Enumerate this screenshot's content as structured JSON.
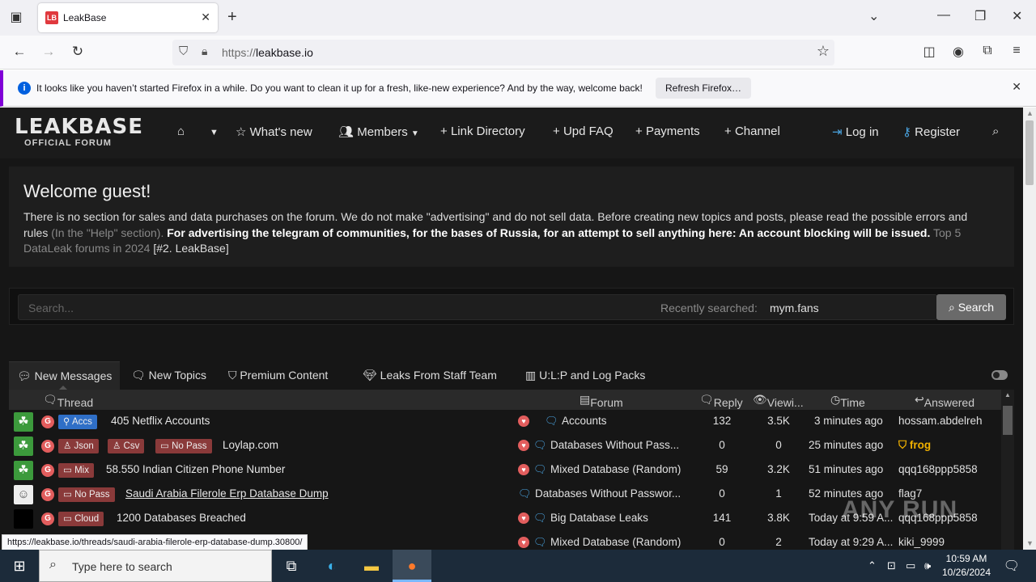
{
  "browser": {
    "tab_title": "LeakBase",
    "favicon_text": "LB",
    "url_host": "https://",
    "url_domain": "leakbase.io",
    "notice_message": "It looks like you haven’t started Firefox in a while. Do you want to clean it up for a fresh, like-new experience? And by the way, welcome back!",
    "notice_button": "Refresh Firefox…",
    "status_url": "https://leakbase.io/threads/saudi-arabia-filerole-erp-database-dump.30800/"
  },
  "site": {
    "logo_line1": "LEAKBASE",
    "logo_line2": "OFFICIAL FORUM",
    "nav": {
      "whats_new": "What's new",
      "members": "Members",
      "link_directory": "Link Directory",
      "upd_faq": "Upd FAQ",
      "payments": "Payments",
      "channel": "Channel",
      "login": "Log in",
      "register": "Register"
    }
  },
  "welcome": {
    "title": "Welcome guest!",
    "text1": "There is no section for sales and data purchases on the forum. We do not make \"advertising\" and do not sell data. Before creating new topics and posts, please read the possible errors and rules ",
    "text_muted1": "(In the \"Help\" section). ",
    "text_bold": "For advertising the telegram of communities, for the bases of Russia, for an attempt to sell anything here: An account blocking will be issued.",
    "text_muted2": " Top 5 DataLeak forums in 2024 ",
    "text_end": "[#2. LeakBase]"
  },
  "search": {
    "placeholder": "Search...",
    "recent_label": "Recently searched:",
    "recent_value": "mym.fans",
    "button": "Search"
  },
  "tabs": [
    "New Messages",
    "New Topics",
    "Premium Content",
    "Leaks From Staff Team",
    "U:L:P and Log Packs"
  ],
  "table_headers": {
    "thread": "Thread",
    "forum": "Forum",
    "reply": "Reply",
    "views": "Viewi...",
    "time": "Time",
    "answered": "Answered"
  },
  "rows": [
    {
      "tags": [
        "Accs"
      ],
      "title": "405 Netflix Accounts",
      "forum": "Accounts",
      "reply": "132",
      "views": "3.5K",
      "time": "3 minutes ago",
      "answered": "hossam.abdelreh"
    },
    {
      "tags": [
        "Json",
        "Csv",
        "No Pass"
      ],
      "title": "Loylap.com",
      "forum": "Databases Without Pass...",
      "reply": "0",
      "views": "0",
      "time": "25 minutes ago",
      "answered": "frog"
    },
    {
      "tags": [
        "Mix"
      ],
      "title": "58.550 Indian Citizen Phone Number",
      "forum": "Mixed Database (Random)",
      "reply": "59",
      "views": "3.2K",
      "time": "51 minutes ago",
      "answered": "qqq168ppp5858"
    },
    {
      "tags": [
        "No Pass"
      ],
      "title": "Saudi Arabia Filerole Erp Database Dump",
      "forum": "Databases Without Passwor...",
      "reply": "0",
      "views": "1",
      "time": "52 minutes ago",
      "answered": "flag7"
    },
    {
      "tags": [
        "Cloud"
      ],
      "title": "1200 Databases Breached",
      "forum": "Big Database Leaks",
      "reply": "141",
      "views": "3.8K",
      "time": "Today at 9:59 A...",
      "answered": "qqq168ppp5858"
    },
    {
      "tags": [],
      "title": "",
      "forum": "Mixed Database (Random)",
      "reply": "0",
      "views": "2",
      "time": "Today at 9:29 A...",
      "answered": "kiki_9999"
    }
  ],
  "watermark": "ANY RUN",
  "taskbar": {
    "search_placeholder": "Type here to search",
    "time": "10:59 AM",
    "date": "10/26/2024"
  }
}
